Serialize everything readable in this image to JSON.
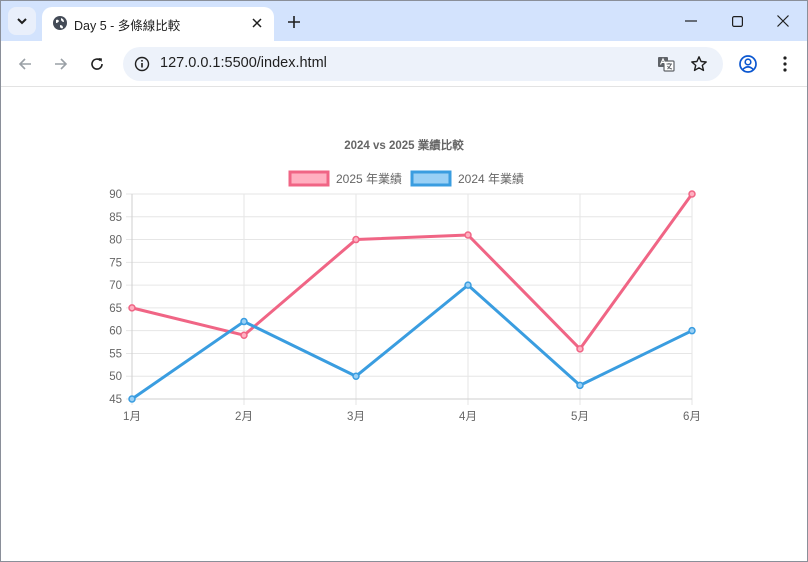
{
  "browser": {
    "tab_title": "Day 5 - 多條線比較",
    "url": "127.0.0.1:5500/index.html"
  },
  "colors": {
    "tabstrip": "#d3e3fd",
    "omnibox": "#edf2fa",
    "series_2025": "#f06585",
    "series_2024": "#3a9de0",
    "grid": "#e6e6e6",
    "text": "#666666"
  },
  "icons": [
    "tab-search-icon",
    "globe-icon",
    "close-icon",
    "plus-icon",
    "minimize-icon",
    "maximize-icon",
    "back-icon",
    "forward-icon",
    "reload-icon",
    "info-icon",
    "translate-icon",
    "star-icon",
    "profile-icon",
    "menu-icon"
  ],
  "chart_data": {
    "type": "line",
    "title": "2024 vs 2025 業績比較",
    "categories": [
      "1月",
      "2月",
      "3月",
      "4月",
      "5月",
      "6月"
    ],
    "series": [
      {
        "name": "2025 年業績",
        "values": [
          65,
          59,
          80,
          81,
          56,
          90
        ],
        "color": "#f06585",
        "fill": "#ffb0c1"
      },
      {
        "name": "2024 年業績",
        "values": [
          45,
          62,
          50,
          70,
          48,
          60
        ],
        "color": "#3a9de0",
        "fill": "#9ad0f5"
      }
    ],
    "ylim": [
      45,
      90
    ],
    "yticks": [
      45,
      50,
      55,
      60,
      65,
      70,
      75,
      80,
      85,
      90
    ],
    "grid": true,
    "legend": "top-center"
  }
}
